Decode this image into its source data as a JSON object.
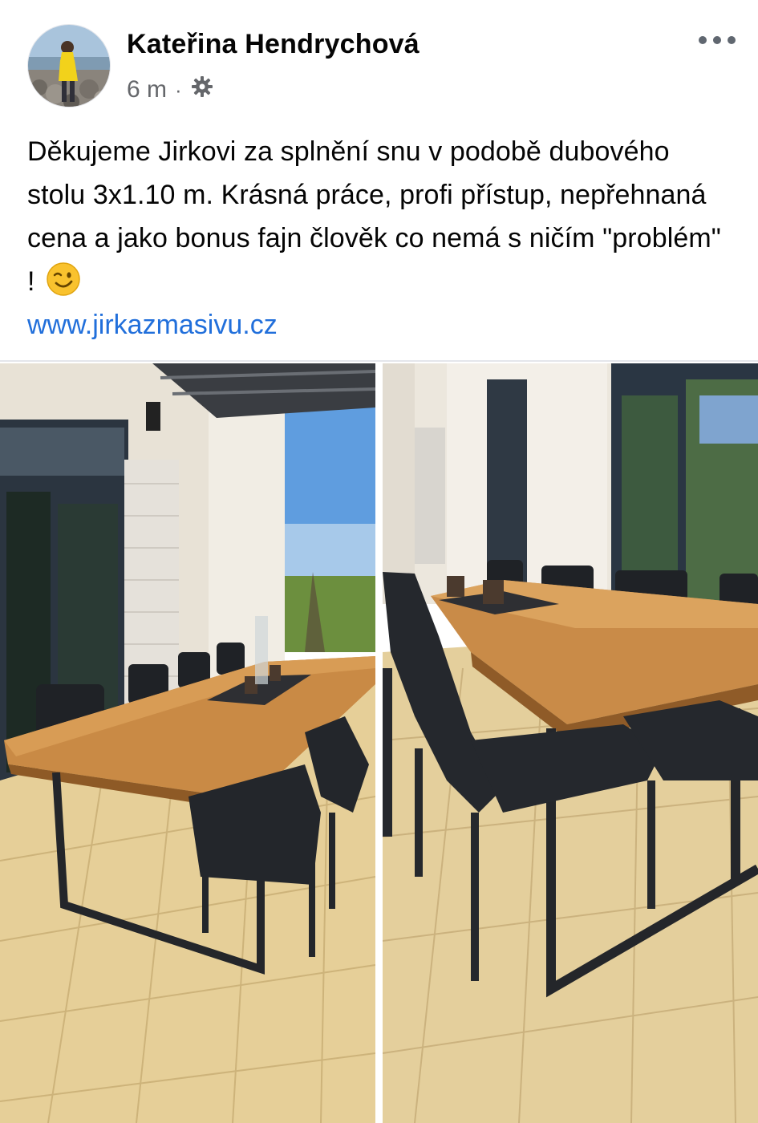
{
  "post": {
    "author": "Kateřina Hendrychová",
    "time": "6 m",
    "separator": "·",
    "privacy_icon": "gear-icon",
    "more_icon": "more-horizontal-icon",
    "text": "Děkujeme Jirkovi za splnění snu v podobě dubového stolu 3x1.10 m. Krásná práce, profi přístup, nepřehnaná cena a jako bonus fajn člověk co nemá s ničím \"problém\" !",
    "emoji": "winking-face-emoji",
    "link": "www.jirkazmasivu.cz"
  },
  "photos": [
    {
      "name": "terrace-oak-table-photo-1",
      "description_icon": "photo"
    },
    {
      "name": "terrace-oak-table-photo-2",
      "description_icon": "photo"
    }
  ],
  "colors": {
    "text": "#050505",
    "secondary": "#65676b",
    "link": "#216fdb",
    "divider": "#e4e6eb"
  }
}
